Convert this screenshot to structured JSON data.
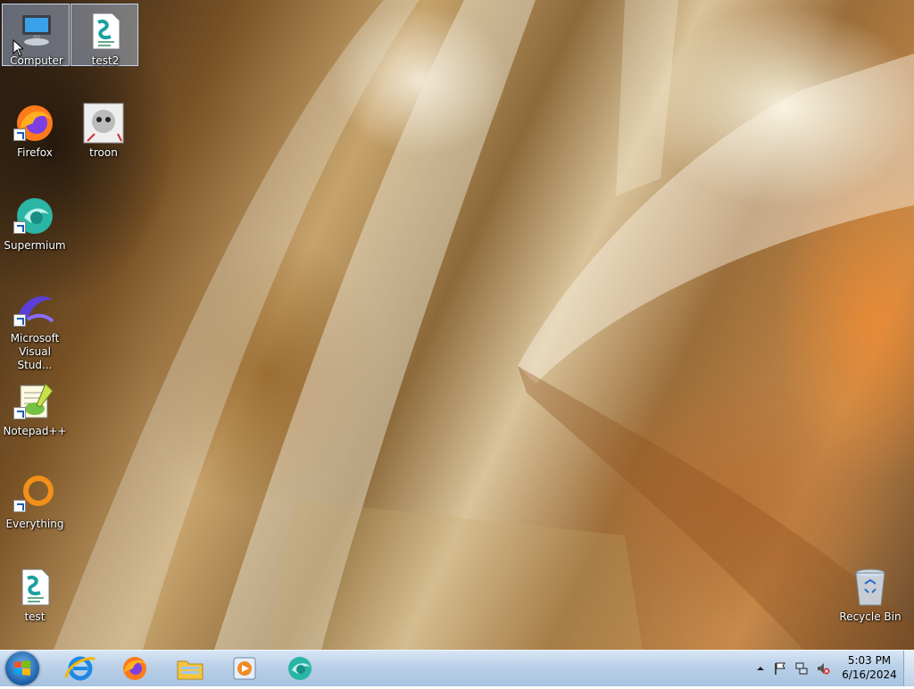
{
  "desktop": {
    "icons": [
      {
        "label": "Computer",
        "icon": "computer-icon"
      },
      {
        "label": "test2",
        "icon": "script-file-icon"
      },
      {
        "label": "Firefox",
        "icon": "firefox-icon"
      },
      {
        "label": "troon",
        "icon": "image-file-icon"
      },
      {
        "label": "Supermium",
        "icon": "supermium-icon"
      },
      {
        "label": "Microsoft Visual Stud...",
        "icon": "visual-studio-icon"
      },
      {
        "label": "Notepad++",
        "icon": "notepadpp-icon"
      },
      {
        "label": "Everything",
        "icon": "everything-search-icon"
      },
      {
        "label": "test",
        "icon": "script-file-icon"
      },
      {
        "label": "Recycle Bin",
        "icon": "recycle-bin-icon"
      }
    ]
  },
  "taskbar": {
    "start": {
      "icon": "windows-start-icon"
    },
    "pinned": [
      {
        "icon": "internet-explorer-icon"
      },
      {
        "icon": "firefox-icon"
      },
      {
        "icon": "file-explorer-icon"
      },
      {
        "icon": "media-player-icon"
      },
      {
        "icon": "supermium-icon"
      }
    ],
    "tray": {
      "icons": [
        "show-hidden-icons-arrow",
        "action-center-flag-icon",
        "network-icon",
        "volume-muted-icon"
      ],
      "time": "5:03 PM",
      "date": "6/16/2024"
    }
  },
  "colors": {
    "taskbar_top": "#d7e6f5",
    "taskbar_bottom": "#a8c3e0",
    "selection": "#aac8f0"
  }
}
